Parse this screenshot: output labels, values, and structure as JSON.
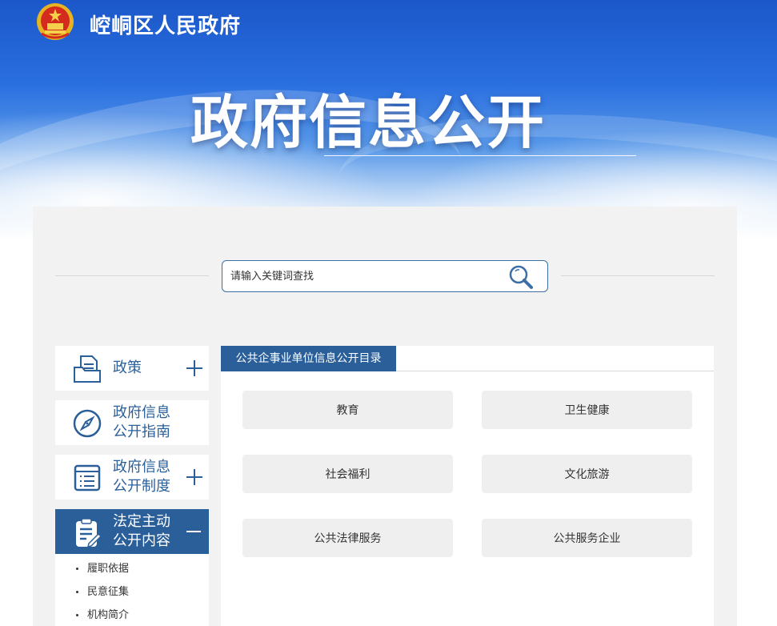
{
  "header": {
    "site_name": "崆峒区人民政府",
    "hero_title": "政府信息公开"
  },
  "search": {
    "placeholder": "请输入关键词查找"
  },
  "sidebar": {
    "items": [
      {
        "lines": [
          "政策"
        ],
        "icon": "folder-document-icon",
        "toggle": "plus"
      },
      {
        "lines": [
          "政府信息",
          "公开指南"
        ],
        "icon": "compass-icon",
        "toggle": "none"
      },
      {
        "lines": [
          "政府信息",
          "公开制度"
        ],
        "icon": "list-document-icon",
        "toggle": "plus"
      },
      {
        "lines": [
          "法定主动",
          "公开内容"
        ],
        "icon": "clipboard-edit-icon",
        "toggle": "minus"
      }
    ],
    "sub_items": [
      "履职依据",
      "民意征集",
      "机构简介"
    ]
  },
  "content": {
    "tab_title": "公共企事业单位信息公开目录",
    "buttons": [
      "教育",
      "卫生健康",
      "社会福利",
      "文化旅游",
      "公共法律服务",
      "公共服务企业"
    ]
  },
  "colors": {
    "primary": "#2b5f9a",
    "panel_bg": "#f2f2f2",
    "button_bg": "#efefef",
    "hero_blue": "#1b57c9"
  }
}
